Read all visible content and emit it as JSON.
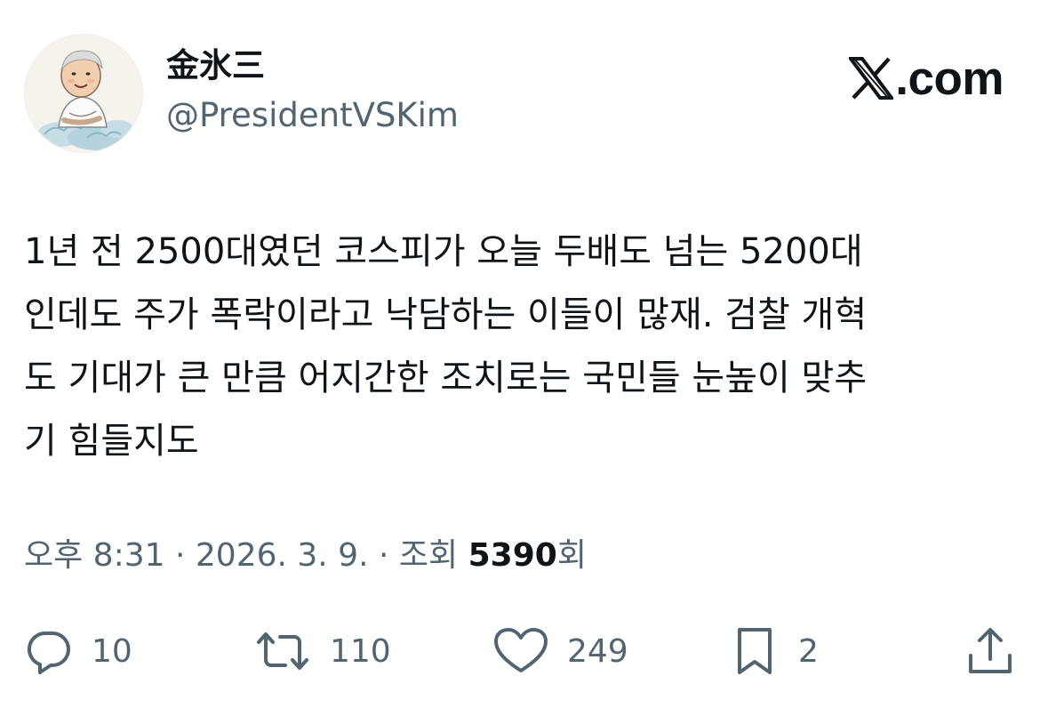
{
  "author": {
    "name": "金氷三",
    "handle": "@PresidentVSKim"
  },
  "brand": {
    "label": ".com",
    "icon": "x-logo-icon"
  },
  "tweet": {
    "lines": [
      "1년 전 2500대였던 코스피가 오늘 두배도 넘는 5200대",
      "인데도 주가 폭락이라고 낙담하는 이들이 많재. 검찰 개혁",
      "도 기대가 큰 만큼 어지간한 조치로는 국민들 눈높이 맞추",
      "기 힘들지도"
    ]
  },
  "meta": {
    "time": "오후 8:31",
    "separator": "·",
    "date": "2026. 3. 9.",
    "views_label": "조회",
    "views_count": "5390",
    "views_suffix": "회"
  },
  "actions": {
    "reply": {
      "icon": "reply-icon",
      "count": "10"
    },
    "repost": {
      "icon": "repost-icon",
      "count": "110"
    },
    "like": {
      "icon": "heart-icon",
      "count": "249"
    },
    "bookmark": {
      "icon": "bookmark-icon",
      "count": "2"
    },
    "share": {
      "icon": "share-icon"
    }
  },
  "colors": {
    "text": "#0f1419",
    "secondary": "#536471",
    "background": "#ffffff"
  }
}
